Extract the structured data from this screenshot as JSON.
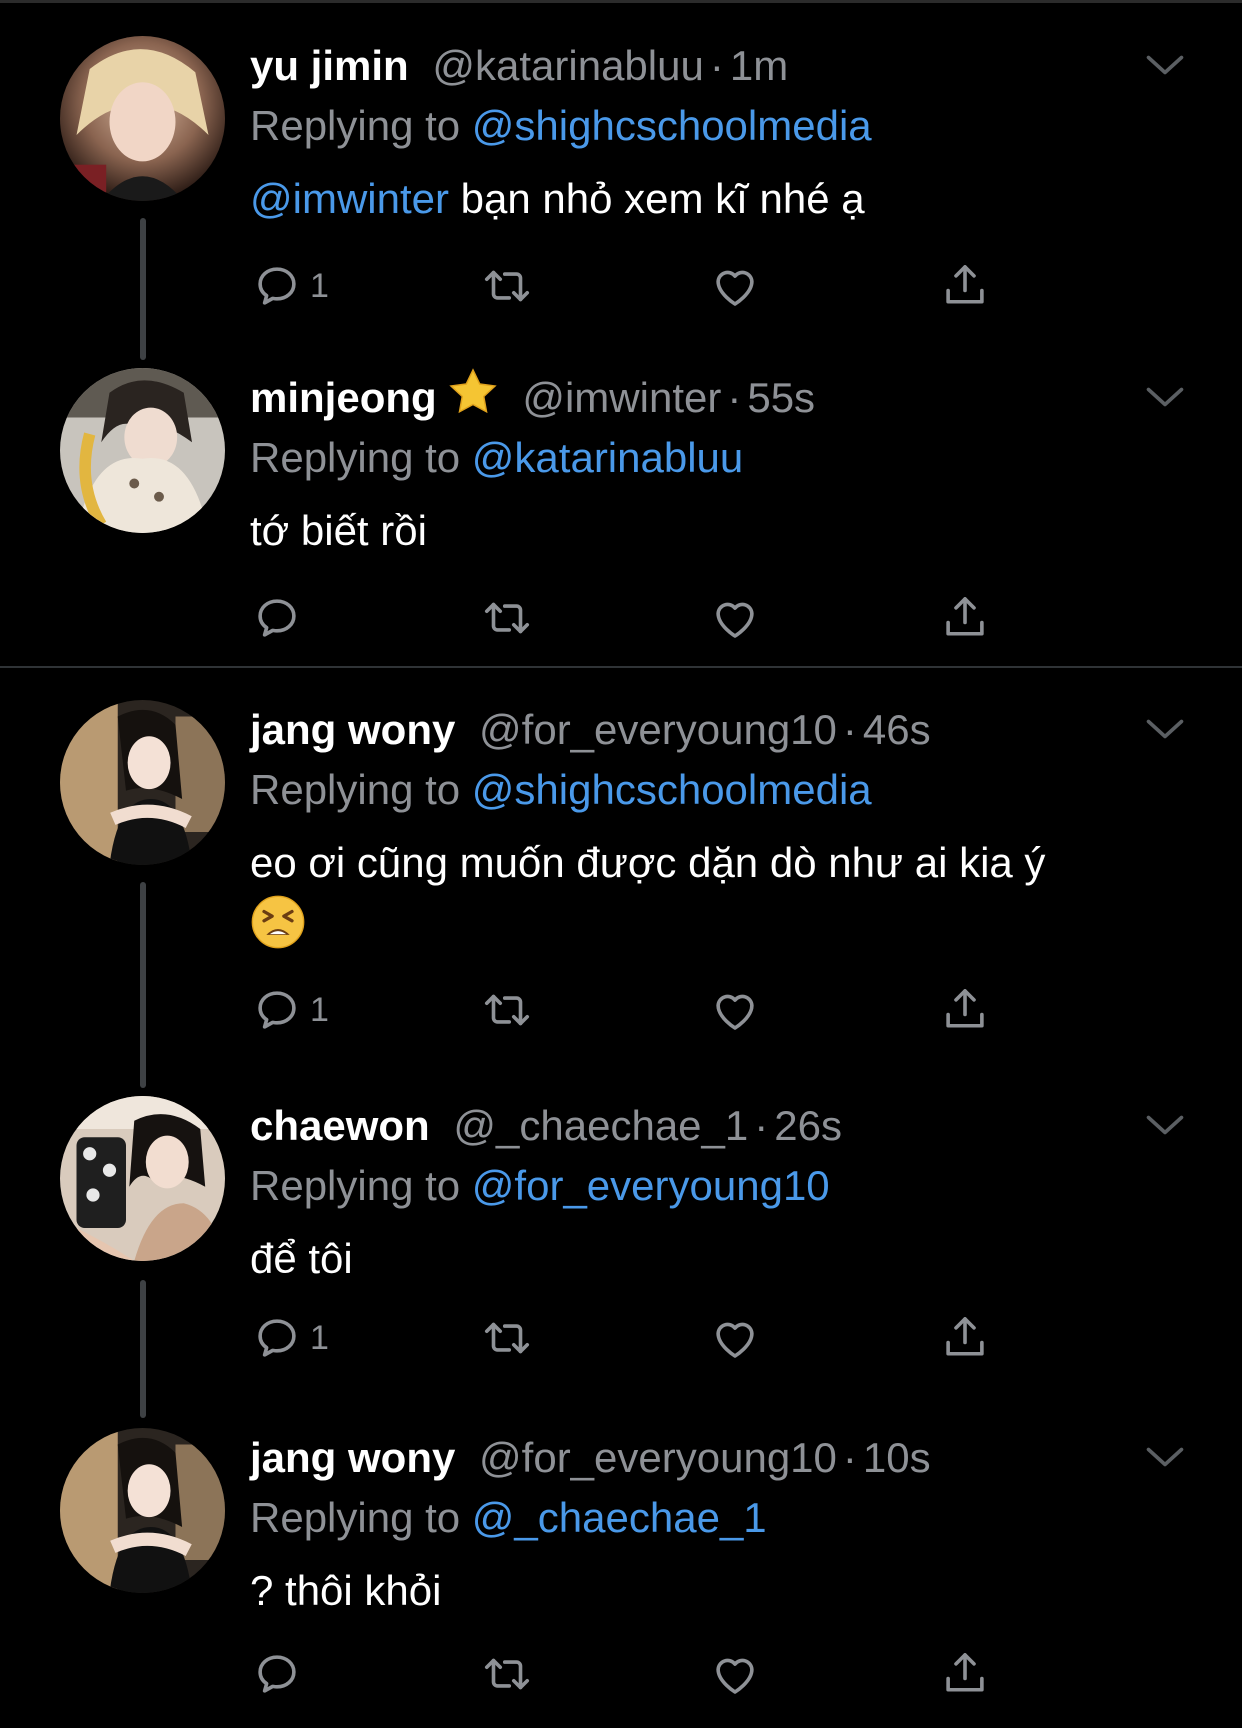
{
  "colors": {
    "background": "#000000",
    "text": "#ffffff",
    "muted": "#8e9196",
    "mention": "#4a99e9",
    "thread_line": "#3e4144"
  },
  "icons": [
    "reply-icon",
    "retweet-icon",
    "like-icon",
    "share-icon",
    "chevron-down-icon",
    "star-emoji-icon",
    "tired-face-emoji-icon"
  ],
  "tweets": [
    {
      "display_name": "yu jimin",
      "handle": "@katarinabluu",
      "separator": "·",
      "time": "1m",
      "reply_prefix": "Replying to",
      "reply_to": "@shighcschoolmedia",
      "body_mention": "@imwinter",
      "body_text": " bạn nhỏ xem kĩ nhé ạ",
      "reply_count": "1"
    },
    {
      "display_name": "minjeong",
      "handle": "@imwinter",
      "separator": "·",
      "time": "55s",
      "reply_prefix": "Replying to",
      "reply_to": "@katarinabluu",
      "body_text": "tớ biết rồi",
      "reply_count": ""
    },
    {
      "display_name": "jang wony",
      "handle": "@for_everyoung10",
      "separator": "·",
      "time": "46s",
      "reply_prefix": "Replying to",
      "reply_to": "@shighcschoolmedia",
      "body_text": "eo ơi cũng muốn được dặn dò như ai kia ý",
      "reply_count": "1"
    },
    {
      "display_name": "chaewon",
      "handle": "@_chaechae_1",
      "separator": "·",
      "time": "26s",
      "reply_prefix": "Replying to",
      "reply_to": "@for_everyoung10",
      "body_text": "để tôi",
      "reply_count": "1"
    },
    {
      "display_name": "jang wony",
      "handle": "@for_everyoung10",
      "separator": "·",
      "time": "10s",
      "reply_prefix": "Replying to",
      "reply_to": "@_chaechae_1",
      "body_text": "? thôi khỏi",
      "reply_count": ""
    }
  ]
}
